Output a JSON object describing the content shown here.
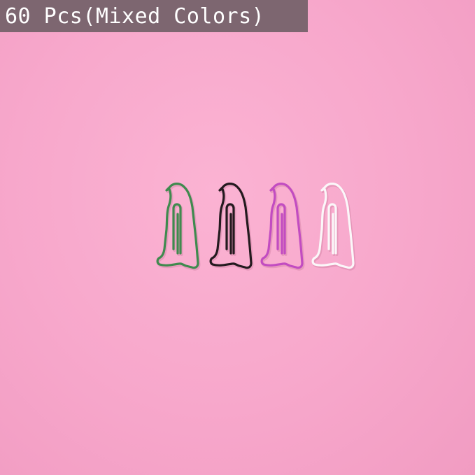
{
  "caption": {
    "text": "60 Pcs(Mixed Colors)",
    "background": "#7d6670",
    "color": "#ffffff"
  },
  "background_color": "#f8a9cd",
  "clips": [
    {
      "name": "green-penguin-clip",
      "color": "#3f8a4e"
    },
    {
      "name": "black-penguin-clip",
      "color": "#241a1f"
    },
    {
      "name": "purple-penguin-clip",
      "color": "#c24cc1"
    },
    {
      "name": "white-penguin-clip",
      "color": "#fbf7f9"
    }
  ]
}
